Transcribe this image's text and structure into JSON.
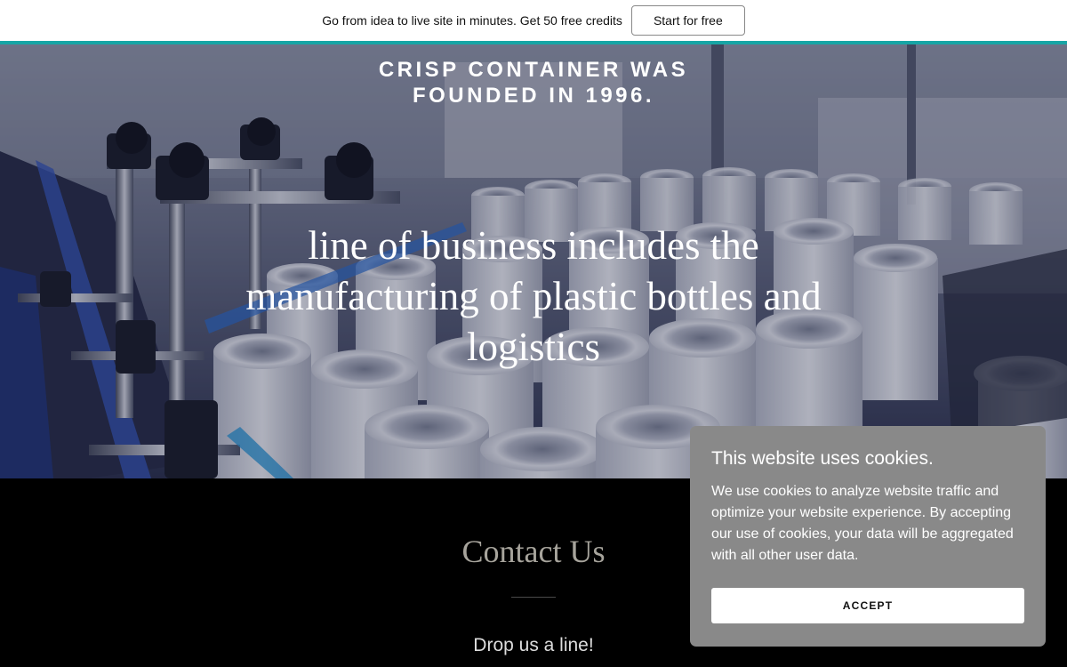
{
  "promo_bar": {
    "text": "Go from idea to live site in minutes. Get 50 free credits",
    "cta_label": "Start for free"
  },
  "hero": {
    "eyebrow": "CRISP CONTAINER WAS FOUNDED IN 1996.",
    "headline": "line of business includes the manufacturing of plastic bottles and logistics",
    "image_subject": "factory conveyor line with white plastic bottles"
  },
  "contact": {
    "title": "Contact Us",
    "subtitle": "Drop us a line!"
  },
  "cookie_banner": {
    "title": "This website uses cookies.",
    "body": "We use cookies to analyze website traffic and optimize your website experience. By accepting our use of cookies, your data will be aggregated with all other user data.",
    "accept_label": "ACCEPT"
  },
  "colors": {
    "accent": "#17a5a5",
    "cookie_background": "#898989",
    "contact_title": "#a7a49c"
  }
}
